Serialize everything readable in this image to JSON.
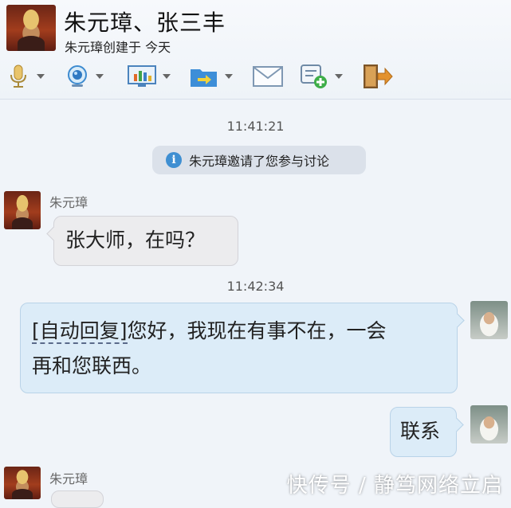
{
  "header": {
    "title": "朱元璋、张三丰",
    "subtitle": "朱元璋创建于 今天"
  },
  "toolbar": {
    "icons": [
      "microphone-icon",
      "video-camera-icon",
      "screen-share-icon",
      "file-transfer-icon",
      "mail-icon",
      "add-note-icon",
      "exit-icon"
    ],
    "accent": "#3f8fd2"
  },
  "timeline": {
    "timestamp1": "11:41:21",
    "system_message": "朱元璋邀请了您参与讨论",
    "message1": {
      "sender": "朱元璋",
      "text": "张大师，在吗？"
    },
    "timestamp2": "11:42:34",
    "message2": {
      "auto_tag": "[自动回复]",
      "line1_rest": "您好，我现在有事不在，一会",
      "line2": "再和您联西。"
    },
    "message3": {
      "text": "联系"
    },
    "message4": {
      "sender": "朱元璋"
    }
  },
  "watermark": "快传号 / 静笃网络立启",
  "colors": {
    "bubble_self": "#dcecf8",
    "bubble_other": "#ececee",
    "background": "#f0f4f9"
  }
}
